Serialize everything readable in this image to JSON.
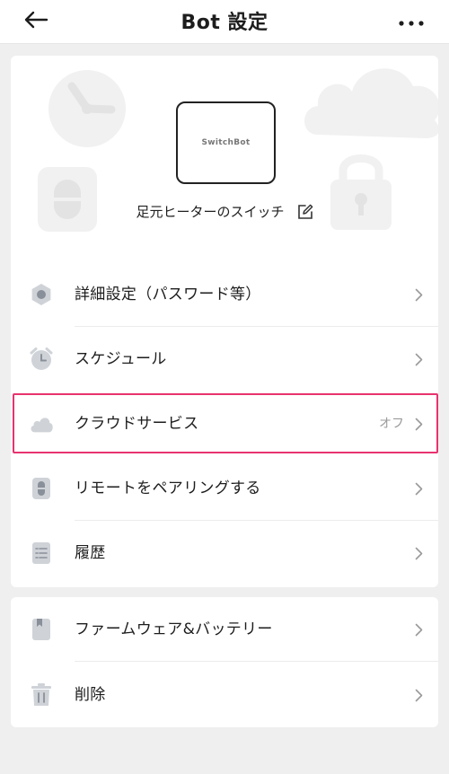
{
  "header": {
    "title": "Bot 設定",
    "back_icon": "arrow-left-icon",
    "more_icon": "more-dots-icon"
  },
  "device": {
    "brand_text": "SwitchBot",
    "name": "足元ヒーターのスイッチ",
    "edit_icon": "edit-icon"
  },
  "menu": {
    "items": [
      {
        "label": "詳細設定（パスワード等）",
        "icon": "settings-hex-icon",
        "value": ""
      },
      {
        "label": "スケジュール",
        "icon": "alarm-clock-icon",
        "value": ""
      },
      {
        "label": "クラウドサービス",
        "icon": "cloud-icon",
        "value": "オフ"
      },
      {
        "label": "リモートをペアリングする",
        "icon": "remote-icon",
        "value": ""
      },
      {
        "label": "履歴",
        "icon": "history-list-icon",
        "value": ""
      }
    ]
  },
  "menu2": {
    "items": [
      {
        "label": "ファームウェア&バッテリー",
        "icon": "firmware-book-icon",
        "value": ""
      },
      {
        "label": "削除",
        "icon": "trash-icon",
        "value": ""
      }
    ]
  },
  "colors": {
    "highlight": "#e8336e",
    "icon_gray": "#cfd3d8",
    "background": "#efefef"
  }
}
